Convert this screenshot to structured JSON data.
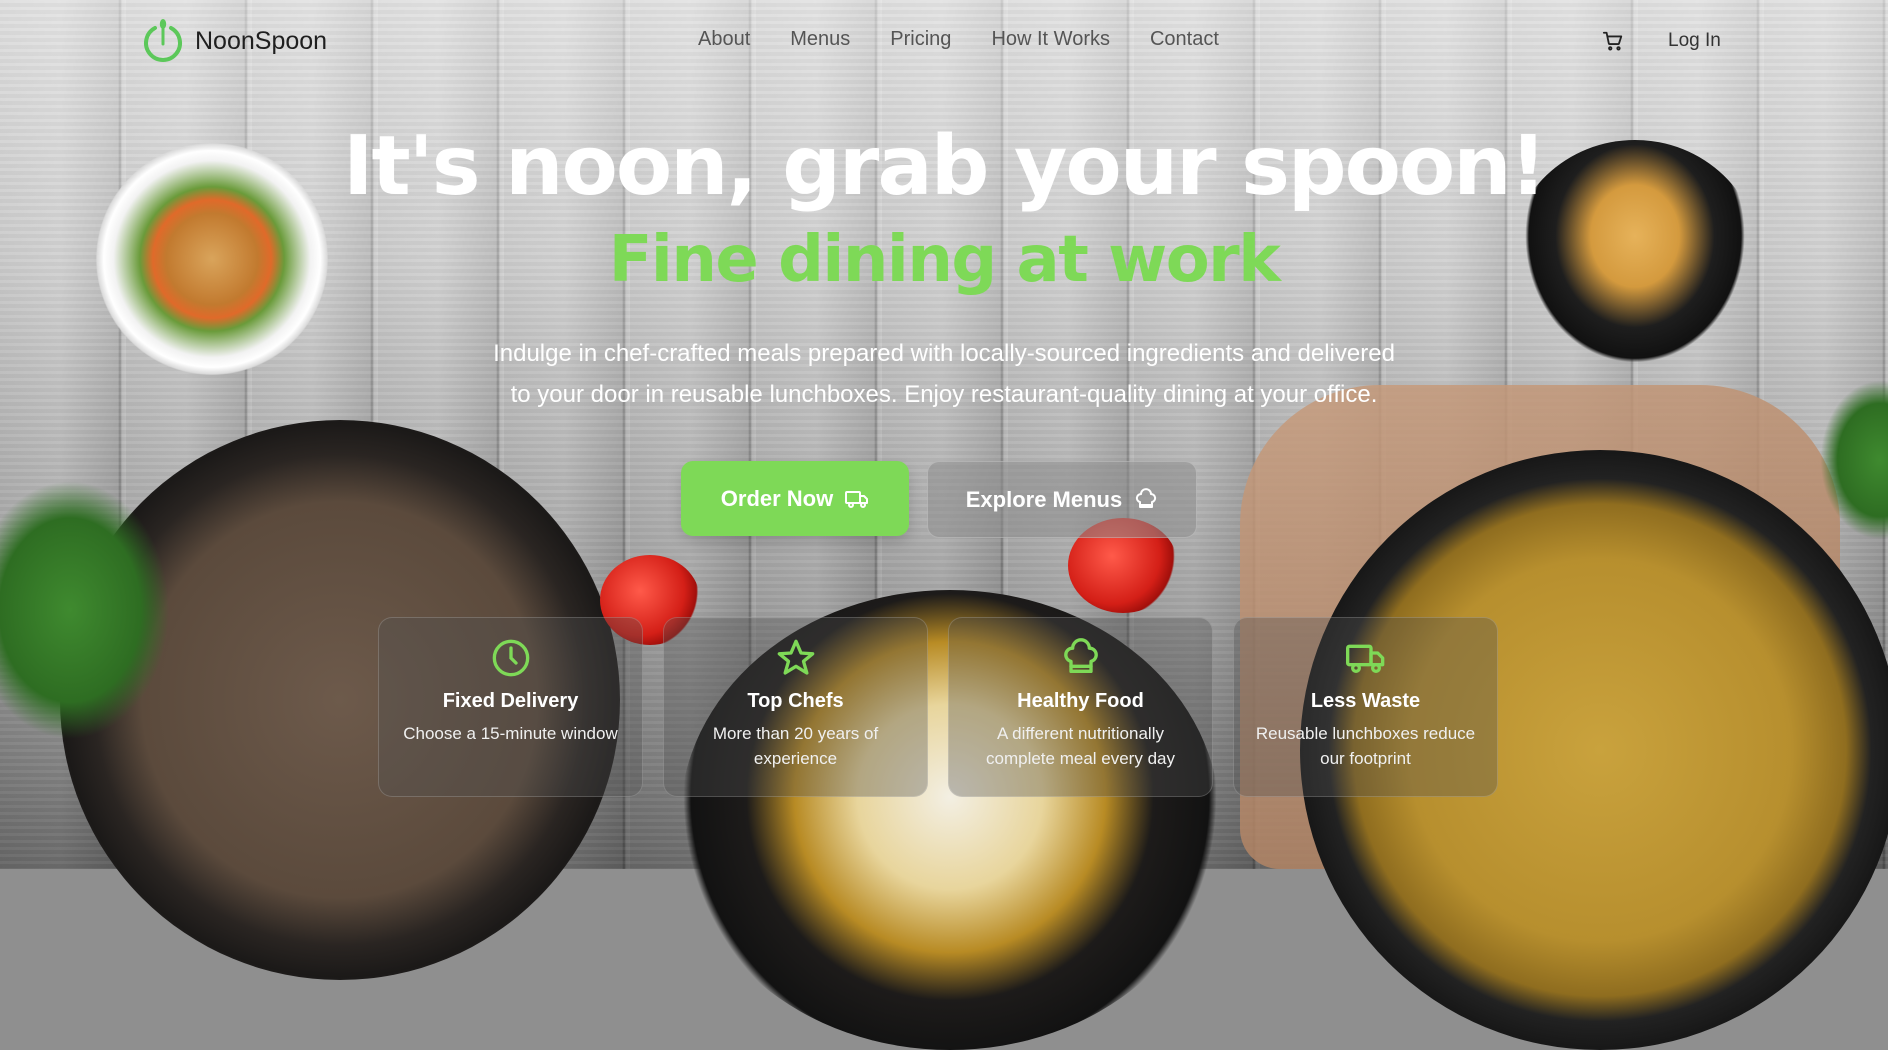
{
  "brand": {
    "name": "NoonSpoon",
    "accent": "#7ed957"
  },
  "nav": {
    "links": [
      "About",
      "Menus",
      "Pricing",
      "How It Works",
      "Contact"
    ],
    "cart_icon": "cart-icon",
    "login": "Log In"
  },
  "hero": {
    "title": "It's noon, grab your spoon!",
    "subtitle": "Fine dining at work",
    "description_line1": "Indulge in chef-crafted meals prepared with locally-sourced ingredients and delivered",
    "description_line2": "to your door in reusable lunchboxes. Enjoy restaurant-quality dining at your office.",
    "primary_button": {
      "label": "Order Now",
      "icon": "truck-icon"
    },
    "secondary_button": {
      "label": "Explore Menus",
      "icon": "chef-hat-icon"
    }
  },
  "features": [
    {
      "icon": "clock-icon",
      "title": "Fixed Delivery",
      "text": "Choose a 15-minute window"
    },
    {
      "icon": "star-icon",
      "title": "Top Chefs",
      "text": "More than 20 years of experience"
    },
    {
      "icon": "chef-hat-icon",
      "title": "Healthy Food",
      "text": "A different nutritionally complete meal every day"
    },
    {
      "icon": "truck-icon",
      "title": "Less Waste",
      "text": "Reusable lunchboxes reduce our footprint"
    }
  ]
}
